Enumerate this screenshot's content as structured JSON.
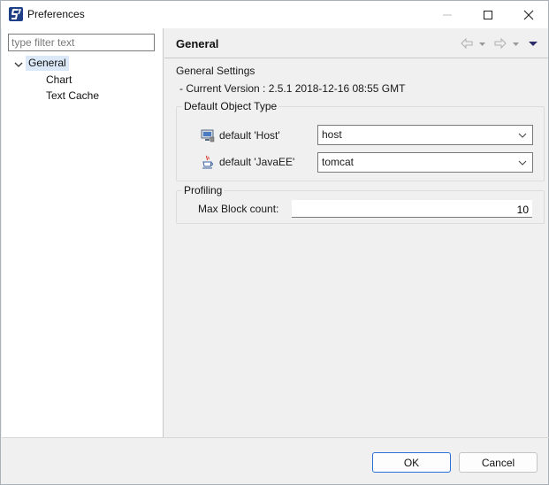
{
  "window": {
    "title": "Preferences",
    "icon": "app-logo-icon",
    "controls": [
      "minimize-icon",
      "maximize-icon",
      "close-icon"
    ]
  },
  "sidebar": {
    "filter_placeholder": "type filter text",
    "tree": [
      {
        "label": "General",
        "expanded": true,
        "selected": true,
        "children": [
          {
            "label": "Chart"
          },
          {
            "label": "Text Cache"
          }
        ]
      }
    ]
  },
  "page": {
    "title": "General",
    "nav_icons": [
      "back-arrow-icon",
      "back-dropdown-icon",
      "forward-arrow-icon",
      "forward-dropdown-icon",
      "view-menu-icon"
    ],
    "settings_label": "General Settings",
    "version_text": "- Current Version : 2.5.1 2018-12-16 08:55 GMT",
    "default_object_type": {
      "title": "Default Object Type",
      "rows": [
        {
          "label": "default 'Host'",
          "value": "host",
          "icon": "host-monitor-icon"
        },
        {
          "label": "default 'JavaEE'",
          "value": "tomcat",
          "icon": "java-cup-icon"
        }
      ]
    },
    "profiling": {
      "title": "Profiling",
      "max_block_label": "Max Block count:",
      "max_block_value": "10"
    }
  },
  "footer": {
    "ok_label": "OK",
    "cancel_label": "Cancel"
  },
  "colors": {
    "selection": "#dbe8f7",
    "accent": "#2a6fd6",
    "background": "#f0f0f0"
  }
}
